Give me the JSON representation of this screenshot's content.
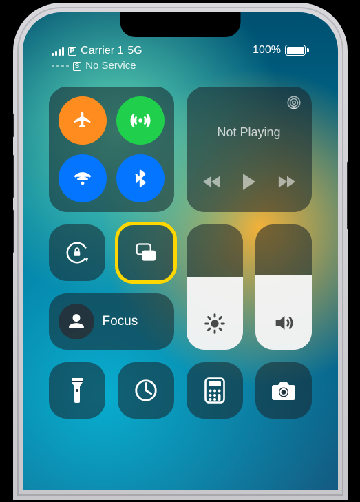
{
  "status": {
    "primary_sim_tag": "P",
    "carrier": "Carrier 1",
    "network_type": "5G",
    "secondary_sim_tag": "S",
    "secondary_text": "No Service",
    "battery_text": "100%"
  },
  "media": {
    "now_playing": "Not Playing"
  },
  "controls": {
    "focus_label": "Focus"
  },
  "sliders": {
    "brightness_fill_css": "height:58%",
    "volume_fill_css": "height:60%"
  },
  "colors": {
    "airplane": "#f58f34",
    "cellular": "#35c759",
    "wifi": "#1473e6",
    "bluetooth": "#1473e6"
  }
}
